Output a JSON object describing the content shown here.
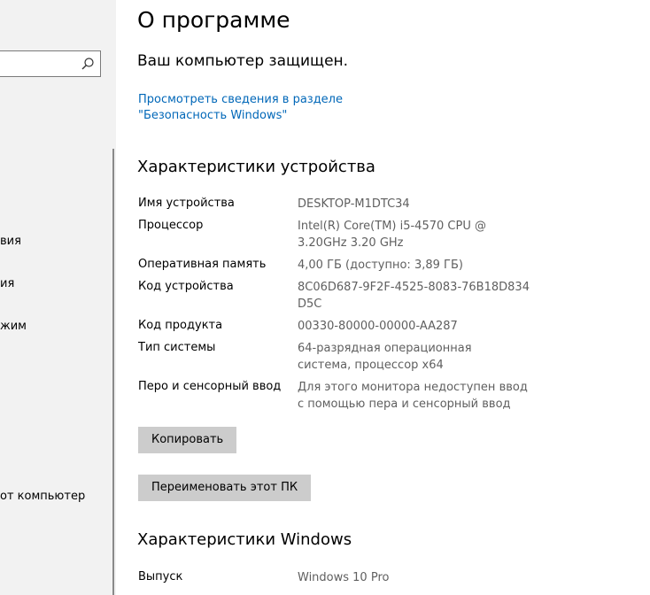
{
  "sidebar": {
    "search": {
      "placeholder": ""
    },
    "items": [
      {
        "label": "вия"
      },
      {
        "label": "ия"
      },
      {
        "label": "жим"
      },
      {
        "label": "от компьютер"
      }
    ]
  },
  "main": {
    "title": "О программе",
    "protected_text": "Ваш компьютер защищен.",
    "security_link": "Просмотреть сведения в разделе \"Безопасность Windows\"",
    "device_specs": {
      "title": "Характеристики устройства",
      "rows": [
        {
          "label": "Имя устройства",
          "value": "DESKTOP-M1DTC34"
        },
        {
          "label": "Процессор",
          "value": "Intel(R) Core(TM) i5-4570 CPU @ 3.20GHz 3.20 GHz"
        },
        {
          "label": "Оперативная память",
          "value": "4,00 ГБ (доступно: 3,89 ГБ)"
        },
        {
          "label": "Код устройства",
          "value": "8C06D687-9F2F-4525-8083-76B18D834D5C"
        },
        {
          "label": "Код продукта",
          "value": "00330-80000-00000-AA287"
        },
        {
          "label": "Тип системы",
          "value": "64-разрядная операционная система, процессор x64"
        },
        {
          "label": "Перо и сенсорный ввод",
          "value": "Для этого монитора недоступен ввод с помощью пера и сенсорный ввод"
        }
      ],
      "copy_button": "Копировать",
      "rename_button": "Переименовать этот ПК"
    },
    "windows_specs": {
      "title": "Характеристики Windows",
      "rows": [
        {
          "label": "Выпуск",
          "value": "Windows 10 Pro"
        }
      ]
    }
  },
  "colors": {
    "link": "#0067b8",
    "button_bg": "#cccccc",
    "sidebar_bg": "#f2f2f2",
    "value_text": "#5f5f5f"
  }
}
